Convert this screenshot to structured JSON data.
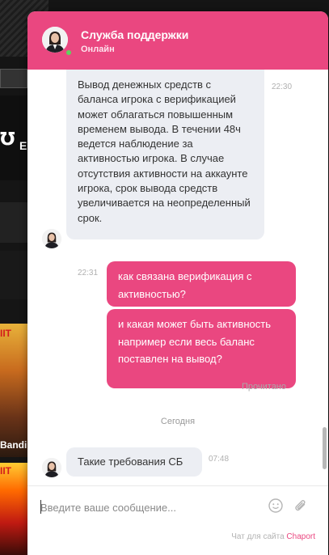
{
  "page": {
    "background_color": "#151515"
  },
  "background_site": {
    "logo_glyph": "℧",
    "logo_letter": "E",
    "game1_badge": "IIT",
    "game1_name": "Bandi",
    "game2_badge": "IIT"
  },
  "chat": {
    "accent_color": "#ea4780",
    "header": {
      "title": "Служба поддержки",
      "status": "Онлайн",
      "avatar_icon": "agent-avatar-icon"
    },
    "messages": [
      {
        "direction": "incoming",
        "text": "Вывод денежных средств с баланса игрока с верификацией может облагаться повышенным временем вывода. В течении 48ч ведется наблюдение за активностью игрока. В случае отсутствия активности на аккаунте игрока, срок вывода средств увеличивается на неопределенный срок.",
        "time": "22:30"
      },
      {
        "direction": "outgoing",
        "text": "как связана верификация с активностью?",
        "time": "22:31"
      },
      {
        "direction": "outgoing",
        "text": "и какая может быть активность например если весь баланс поставлен на вывод?",
        "time": ""
      },
      {
        "direction": "incoming",
        "text": "Такие требования СБ",
        "time": "07:48"
      }
    ],
    "read_status": "Прочитано",
    "day_separator": "Сегодня",
    "input": {
      "placeholder": "Введите ваше сообщение...",
      "value": ""
    },
    "emoji_icon": "smiley-icon",
    "attach_icon": "paperclip-icon",
    "powered_by": "Чат для сайта",
    "powered_brand": "Chaport"
  }
}
